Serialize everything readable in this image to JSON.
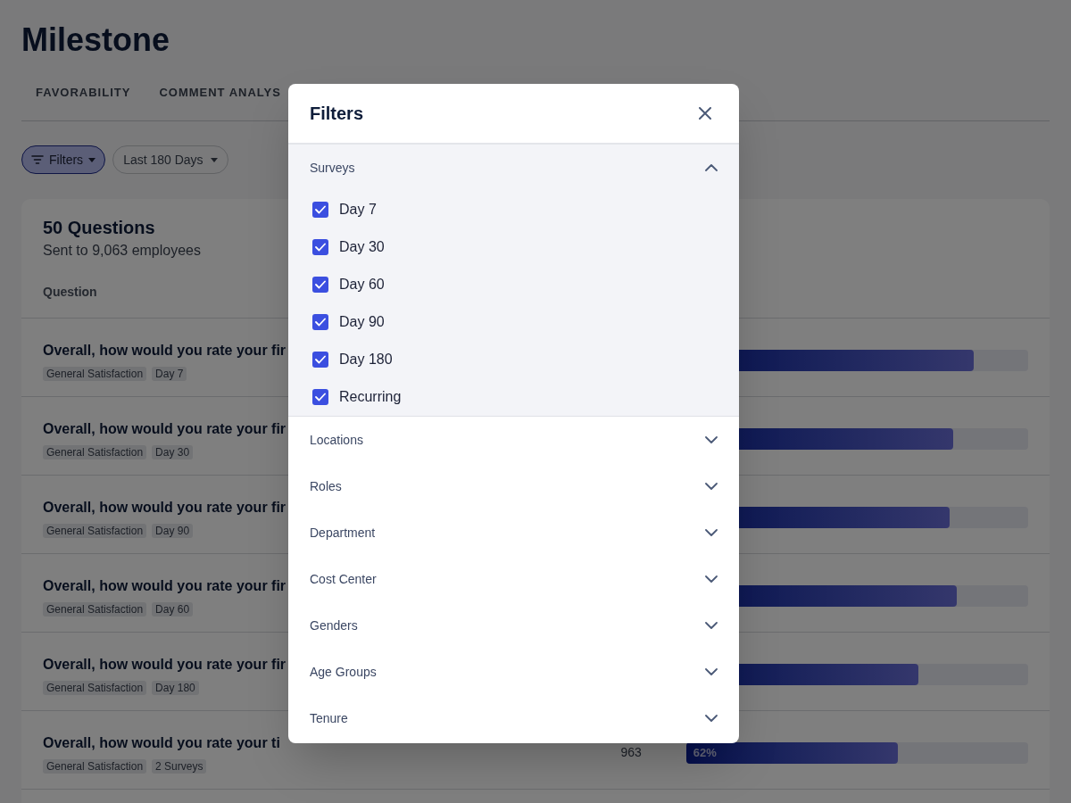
{
  "page": {
    "title": "Milestone"
  },
  "tabs": [
    {
      "label": "FAVORABILITY"
    },
    {
      "label": "COMMENT ANALYS"
    }
  ],
  "toolbar": {
    "filters_button": "Filters",
    "date_range": "Last 180 Days"
  },
  "card": {
    "title": "50 Questions",
    "subtitle": "Sent to 9,063 employees",
    "column_header": "Question",
    "rows": [
      {
        "question": "Overall, how would you rate your fir",
        "tags": [
          "General Satisfaction",
          "Day 7"
        ],
        "level": 0.84
      },
      {
        "question": "Overall, how would you rate your fir",
        "tags": [
          "General Satisfaction",
          "Day 30"
        ],
        "level": 0.78
      },
      {
        "question": "Overall, how would you rate your fir",
        "tags": [
          "General Satisfaction",
          "Day 90"
        ],
        "level": 0.77
      },
      {
        "question": "Overall, how would you rate your fir",
        "tags": [
          "General Satisfaction",
          "Day 60"
        ],
        "level": 0.79
      },
      {
        "question": "Overall, how would you rate your fir",
        "tags": [
          "General Satisfaction",
          "Day 180"
        ],
        "level": 0.68
      },
      {
        "question": "Overall, how would you rate your ti",
        "tags": [
          "General Satisfaction",
          "2 Surveys"
        ],
        "count": "963",
        "percent": "62%",
        "level": 0.62
      }
    ]
  },
  "modal": {
    "title": "Filters",
    "sections": [
      {
        "label": "Surveys",
        "expanded": true,
        "options": [
          {
            "label": "Day 7",
            "checked": true
          },
          {
            "label": "Day 30",
            "checked": true
          },
          {
            "label": "Day 60",
            "checked": true
          },
          {
            "label": "Day 90",
            "checked": true
          },
          {
            "label": "Day 180",
            "checked": true
          },
          {
            "label": "Recurring",
            "checked": true
          }
        ]
      },
      {
        "label": "Locations",
        "expanded": false
      },
      {
        "label": "Roles",
        "expanded": false
      },
      {
        "label": "Department",
        "expanded": false
      },
      {
        "label": "Cost Center",
        "expanded": false
      },
      {
        "label": "Genders",
        "expanded": false
      },
      {
        "label": "Age Groups",
        "expanded": false
      },
      {
        "label": "Tenure",
        "expanded": false
      }
    ]
  }
}
